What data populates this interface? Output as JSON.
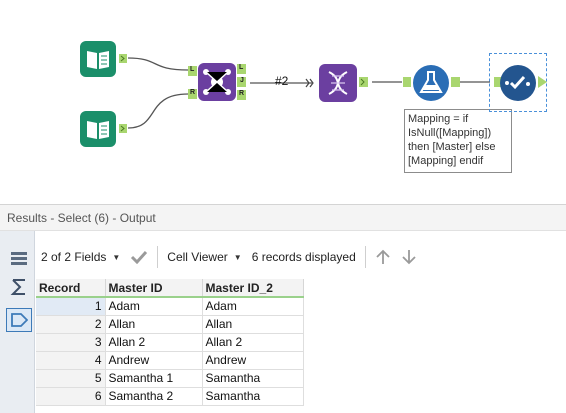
{
  "canvas": {
    "connection_count": "#2",
    "join_anchor_labels": {
      "left": "L",
      "right": "R",
      "out_left": "L",
      "out_join": "J",
      "out_right": "R"
    },
    "annotation": "Mapping = if\nIsNull([Mapping])\nthen [Master] else\n[Mapping] endif",
    "colors": {
      "input_tool": "#1b8f6a",
      "join_tool": "#6b3fa0",
      "select_tool": "#6b3fa0",
      "formula_tool": "#2a6db5",
      "output_tool": "#23558f",
      "anchor": "#a9d66f"
    },
    "icons": [
      "input-book-icon",
      "join-icon",
      "select-dna-icon",
      "formula-flask-icon",
      "browse-check-icon"
    ]
  },
  "results": {
    "header": "Results - Select (6) - Output",
    "toolbar": {
      "fields_label": "2 of 2 Fields",
      "cell_viewer_label": "Cell Viewer",
      "records_label": "6 records displayed"
    },
    "columns": [
      "Record",
      "Master ID",
      "Master ID_2"
    ],
    "rows": [
      [
        "1",
        "Adam",
        "Adam"
      ],
      [
        "2",
        "Allan",
        "Allan"
      ],
      [
        "3",
        "Allan 2",
        "Allan 2"
      ],
      [
        "4",
        "Andrew",
        "Andrew"
      ],
      [
        "5",
        "Samantha 1",
        "Samantha"
      ],
      [
        "6",
        "Samantha 2",
        "Samantha"
      ]
    ]
  }
}
